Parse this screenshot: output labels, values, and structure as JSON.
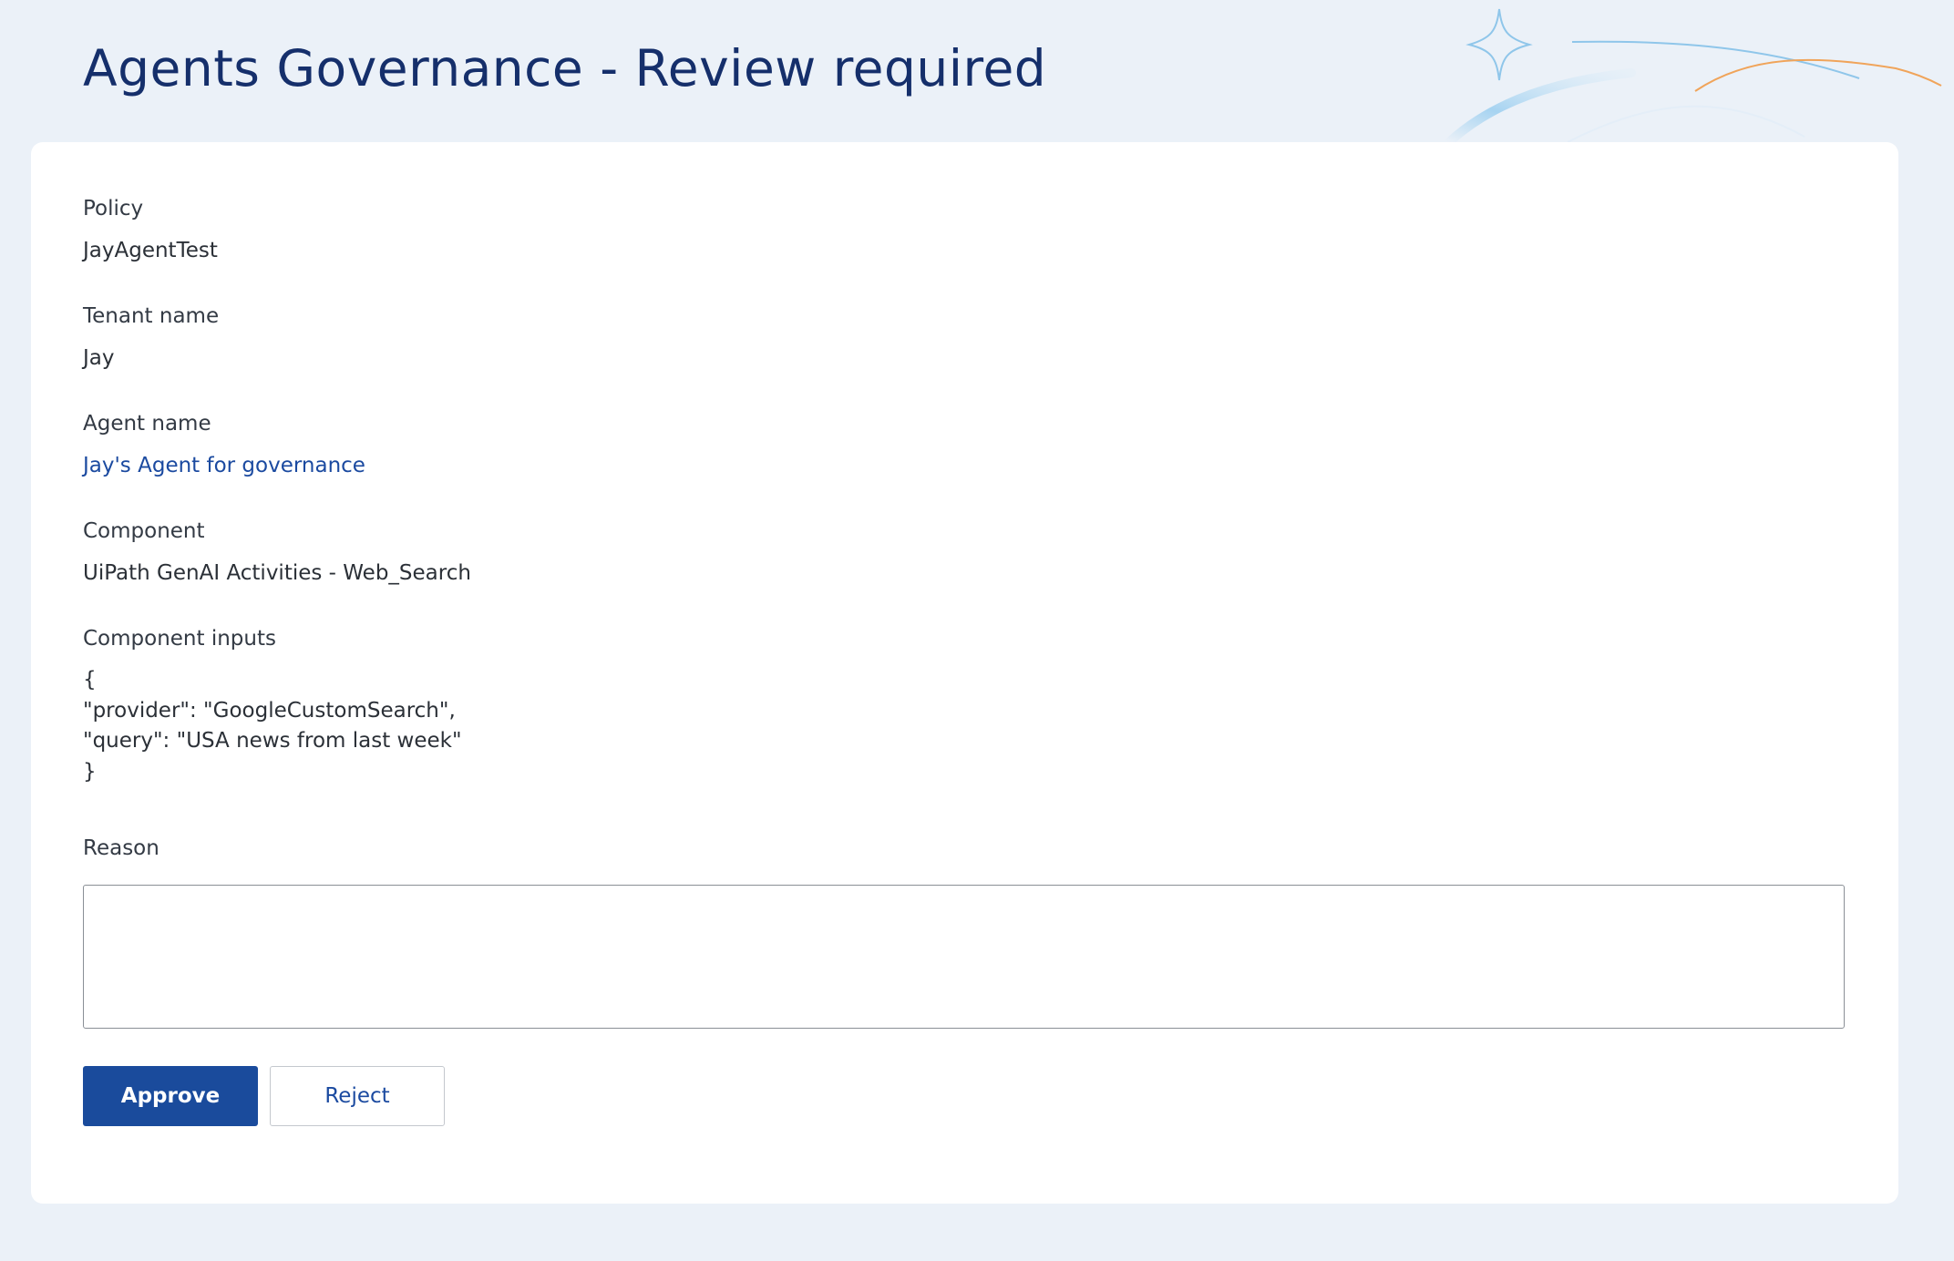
{
  "header": {
    "title": "Agents Governance - Review required"
  },
  "fields": {
    "policy": {
      "label": "Policy",
      "value": "JayAgentTest"
    },
    "tenant": {
      "label": "Tenant name",
      "value": "Jay"
    },
    "agent": {
      "label": "Agent name",
      "value": "Jay's Agent for governance"
    },
    "component": {
      "label": "Component",
      "value": "UiPath GenAI Activities - Web_Search"
    },
    "component_inputs": {
      "label": "Component inputs",
      "lines": [
        "{",
        "\"provider\": \"GoogleCustomSearch\",",
        "\"query\": \"USA news from last week\"",
        "}"
      ]
    }
  },
  "reason": {
    "label": "Reason",
    "value": ""
  },
  "actions": {
    "approve_label": "Approve",
    "reject_label": "Reject"
  },
  "colors": {
    "background": "#ebf1f8",
    "title": "#152f6b",
    "link": "#1b4aa0",
    "primary_button": "#1a4b9c"
  }
}
